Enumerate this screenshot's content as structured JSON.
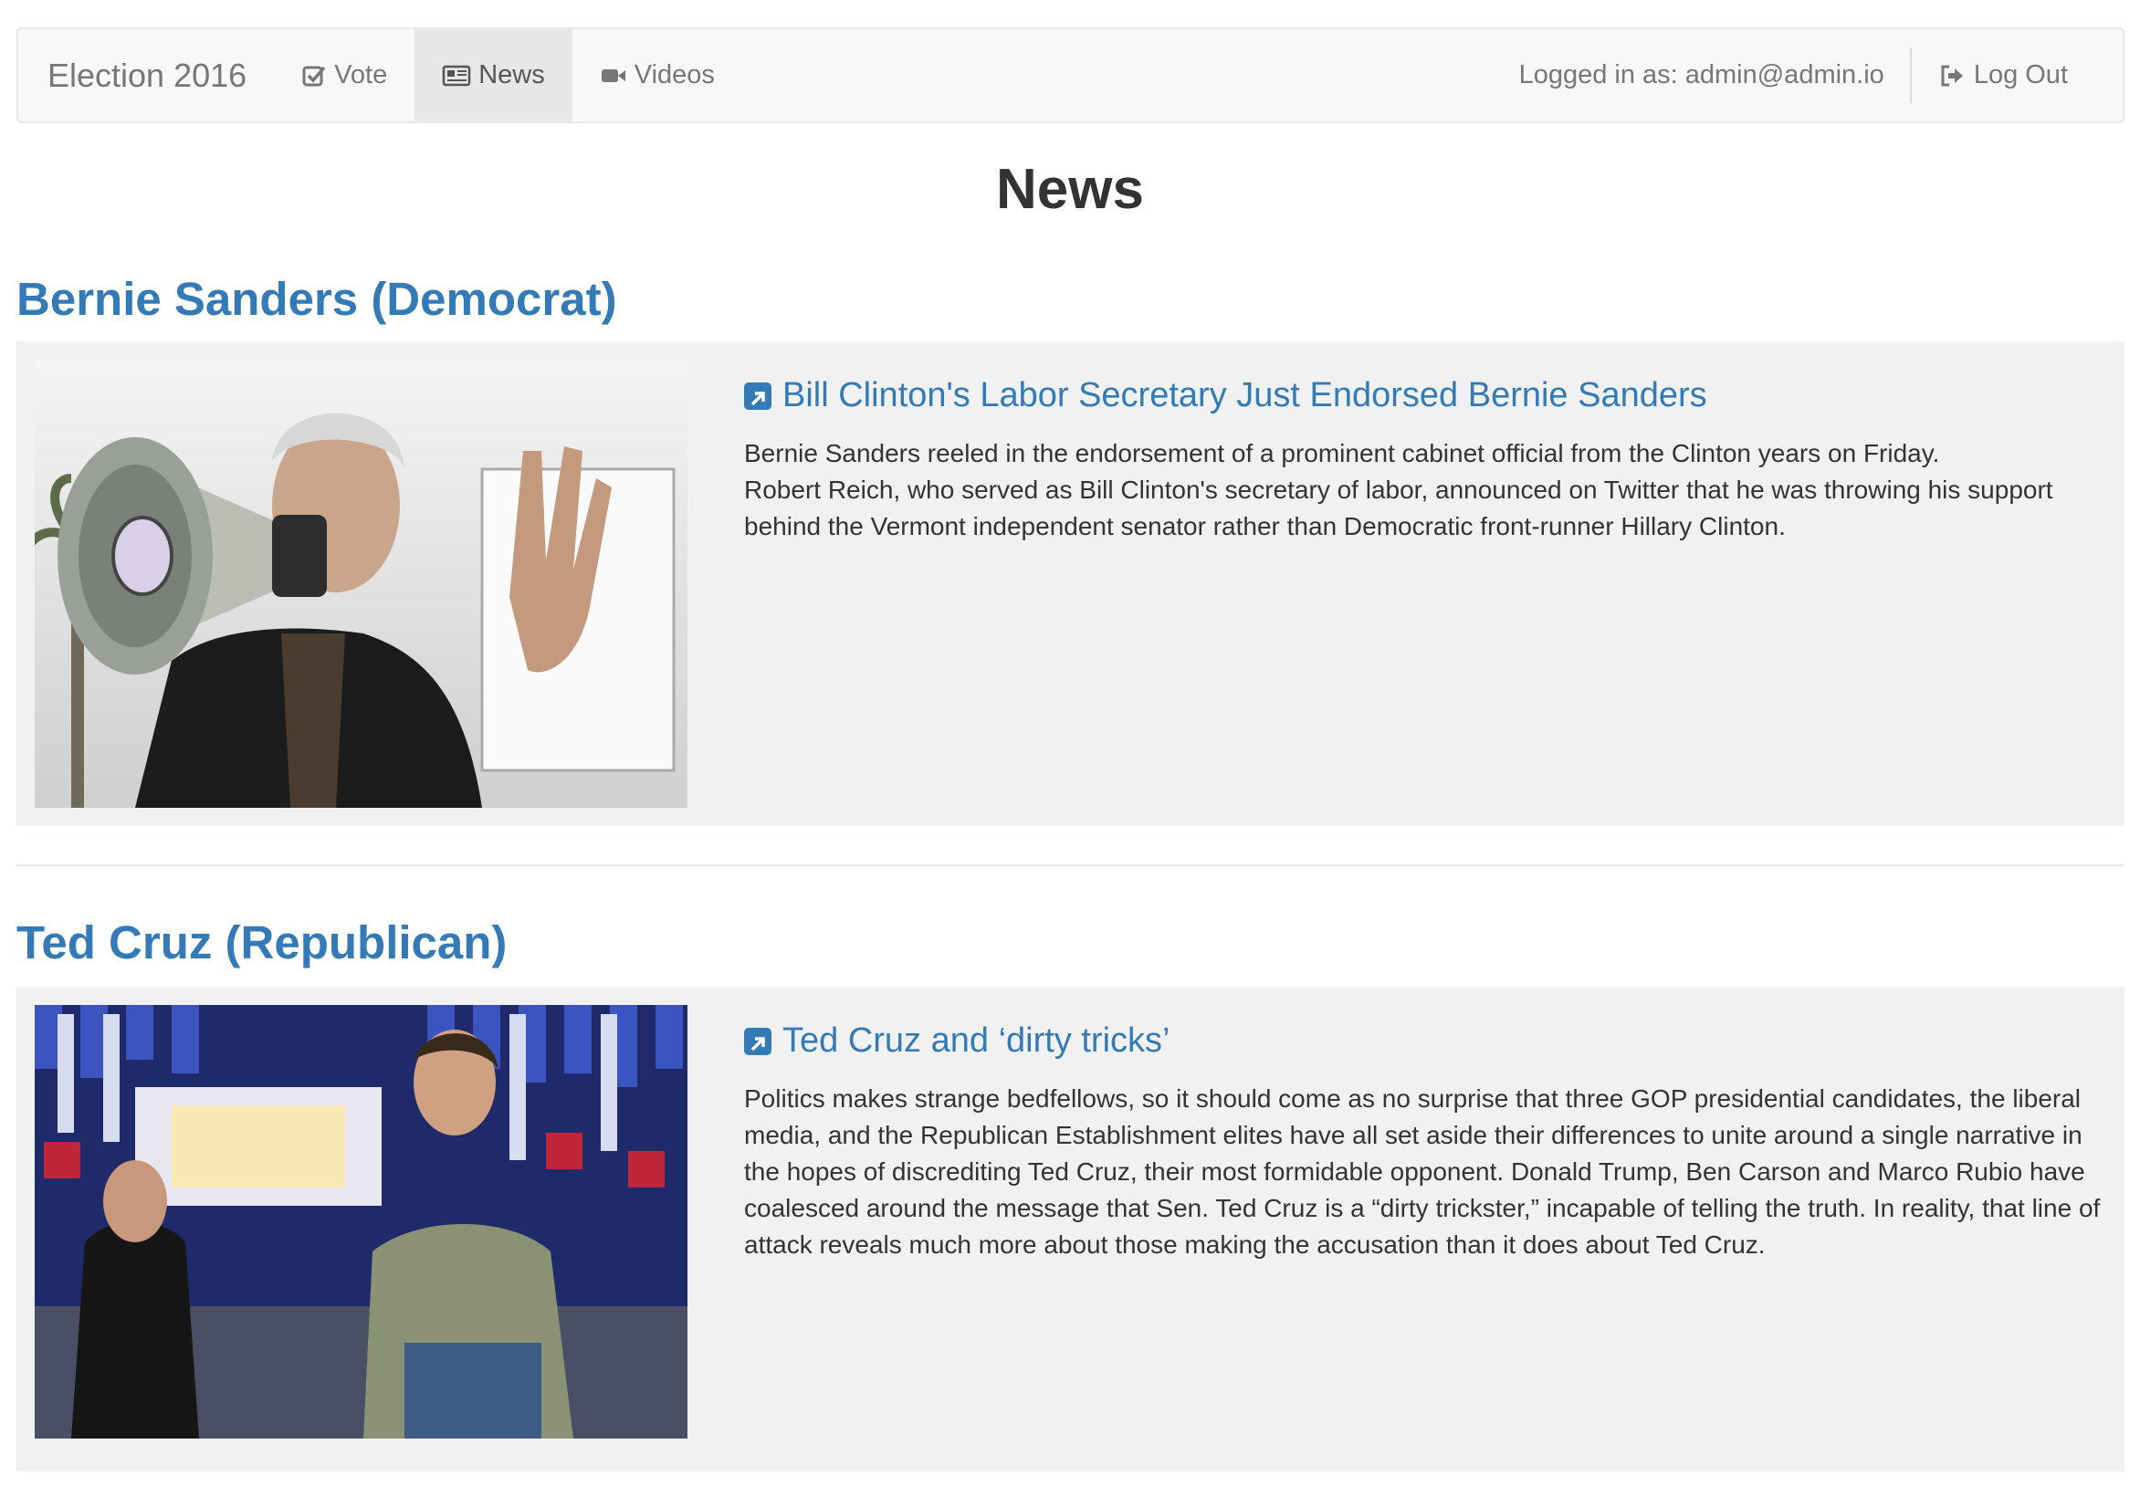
{
  "navbar": {
    "brand": "Election 2016",
    "items": [
      {
        "label": "Vote",
        "icon": "check-square-icon"
      },
      {
        "label": "News",
        "icon": "newspaper-icon",
        "active": true
      },
      {
        "label": "Videos",
        "icon": "video-camera-icon"
      }
    ],
    "logged_in_text": "Logged in as: admin@admin.io",
    "logout_label": "Log Out"
  },
  "page": {
    "title": "News"
  },
  "sections": [
    {
      "heading": "Bernie Sanders (Democrat)",
      "article": {
        "title": "Bill Clinton's Labor Secretary Just Endorsed Bernie Sanders",
        "paragraphs": [
          "Bernie Sanders reeled in the endorsement of a prominent cabinet official from the Clinton years on Friday.",
          "Robert Reich, who served as Bill Clinton's secretary of labor, announced on Twitter that he was throwing his support behind the Vermont independent senator rather than Democratic front-runner Hillary Clinton."
        ]
      }
    },
    {
      "heading": "Ted Cruz (Republican)",
      "article": {
        "title": "Ted Cruz and ‘dirty tricks’",
        "paragraphs": [
          "Politics makes strange bedfellows, so it should come as no surprise that three GOP presidential candidates, the liberal media, and the Republican Establishment elites have all set aside their differences to unite around a single narrative in the hopes of discrediting Ted Cruz, their most formidable opponent. Donald Trump, Ben Carson and Marco Rubio have coalesced around the message that Sen. Ted Cruz is a “dirty trickster,” incapable of telling the truth. In reality, that line of attack reveals much more about those making the accusation than it does about Ted Cruz."
        ]
      }
    }
  ],
  "colors": {
    "link": "#337ab7",
    "navbar_bg": "#f8f8f8",
    "card_bg": "#f1f1f1",
    "nav_text": "#777777"
  }
}
